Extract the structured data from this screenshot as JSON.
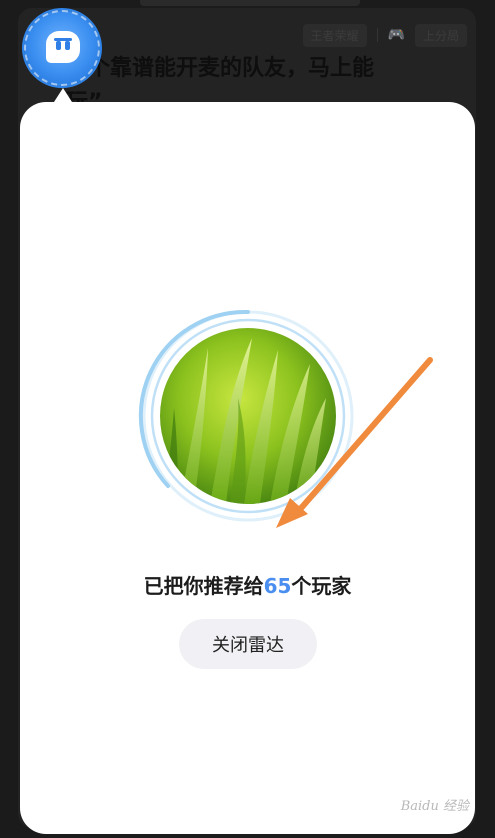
{
  "background": {
    "tags": [
      "王者荣耀",
      "上分局"
    ],
    "post_text": "找个靠谱能开麦的队友，马上能玩”"
  },
  "radar_popup": {
    "headline_prefix": "已把你推荐给",
    "recommended_count": "65",
    "headline_suffix": "个玩家",
    "close_button_label": "关闭雷达"
  },
  "watermark_text": "Baidu 经验",
  "colors": {
    "accent_blue": "#4a8ef0",
    "arrow_orange": "#f08a3c",
    "radar_ring": "#9fd1f2"
  },
  "icons": {
    "avatar": "chat-bubble-face-icon",
    "gamepad": "gamepad-icon"
  }
}
